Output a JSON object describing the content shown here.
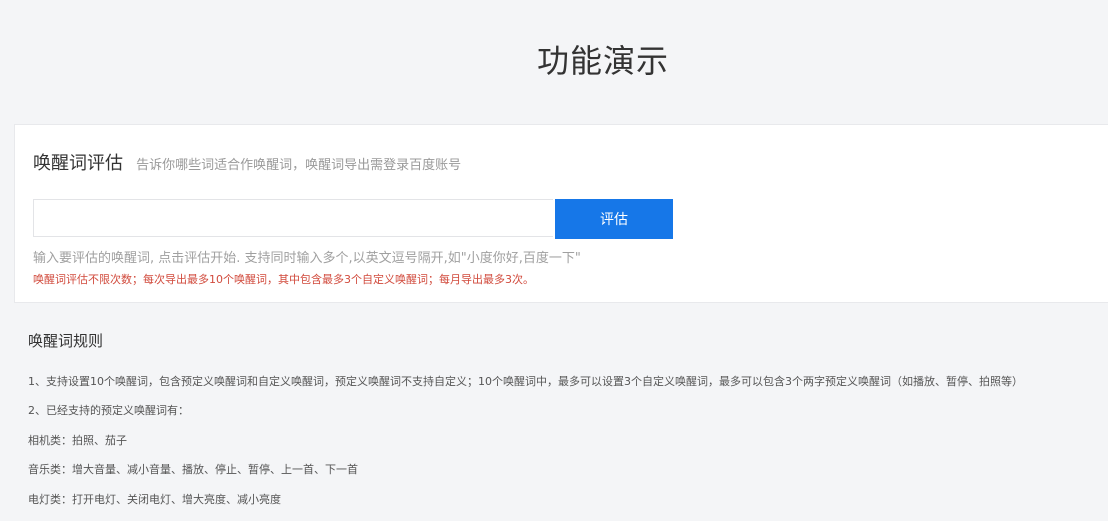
{
  "page": {
    "title": "功能演示"
  },
  "card": {
    "title": "唤醒词评估",
    "subtitle": "告诉你哪些词适合作唤醒词，唤醒词导出需登录百度账号",
    "input_value": "",
    "button_label": "评估",
    "hint": "输入要评估的唤醒词, 点击评估开始. 支持同时输入多个,以英文逗号隔开,如\"小度你好,百度一下\"",
    "limit_note": "唤醒词评估不限次数；每次导出最多10个唤醒词，其中包含最多3个自定义唤醒词；每月导出最多3次。"
  },
  "rules": {
    "title": "唤醒词规则",
    "items": [
      "1、支持设置10个唤醒词，包含预定义唤醒词和自定义唤醒词，预定义唤醒词不支持自定义；10个唤醒词中，最多可以设置3个自定义唤醒词，最多可以包含3个两字预定义唤醒词（如播放、暂停、拍照等）",
      "2、已经支持的预定义唤醒词有：",
      "相机类：拍照、茄子",
      "音乐类：增大音量、减小音量、播放、停止、暂停、上一首、下一首",
      "电灯类：打开电灯、关闭电灯、增大亮度、减小亮度"
    ]
  },
  "colors": {
    "button": "#1677e8",
    "warning": "#d14a3c",
    "background": "#f4f5f7"
  }
}
